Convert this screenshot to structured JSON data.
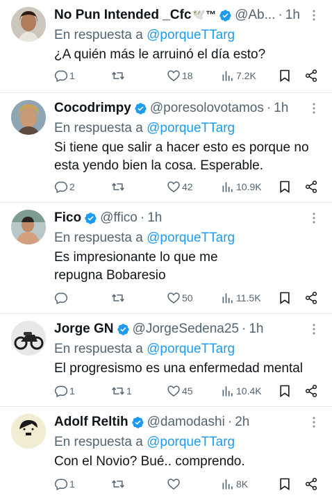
{
  "reply_prefix": "En respuesta a",
  "colors": {
    "accent": "#1d9bf0",
    "secondary": "#536471",
    "text": "#0f1419"
  },
  "tweets": [
    {
      "name": "No Pun Intended _Cfc",
      "name_suffix": "🕊️™",
      "handle": "@Ab...",
      "sep": "·",
      "time": "1h",
      "reply_to": "@porqueTTarg",
      "text": "¿A quién más le arruinó el día esto?",
      "replies": "1",
      "retweets": "",
      "likes": "18",
      "views": "7.2K"
    },
    {
      "name": "Cocodrimpy",
      "name_suffix": "",
      "handle": "@poresolovotamos",
      "sep": "·",
      "time": "1h",
      "reply_to": "@porqueTTarg",
      "text": "Si tiene que salir a hacer esto es porque no esta yendo bien la cosa. Esperable.",
      "replies": "2",
      "retweets": "",
      "likes": "42",
      "views": "10.9K"
    },
    {
      "name": "Fico",
      "name_suffix": "",
      "handle": "@ffico",
      "sep": "·",
      "time": "1h",
      "reply_to": "@porqueTTarg",
      "text": "Es impresionante lo que me repugna Bobaresio",
      "replies": "",
      "retweets": "",
      "likes": "50",
      "views": "11.5K"
    },
    {
      "name": "Jorge GN",
      "name_suffix": "",
      "handle": "@JorgeSedena25",
      "sep": "·",
      "time": "1h",
      "reply_to": "@porqueTTarg",
      "text": "El progresismo es una enfermedad mental",
      "replies": "1",
      "retweets": "1",
      "likes": "45",
      "views": "10.4K"
    },
    {
      "name": "Adolf Reltih",
      "name_suffix": "",
      "handle": "@damodashi",
      "sep": "·",
      "time": "2h",
      "reply_to": "@porqueTTarg",
      "text": "Con el Novio? Bué.. comprendo.",
      "replies": "1",
      "retweets": "",
      "likes": "",
      "views": "8K"
    }
  ]
}
